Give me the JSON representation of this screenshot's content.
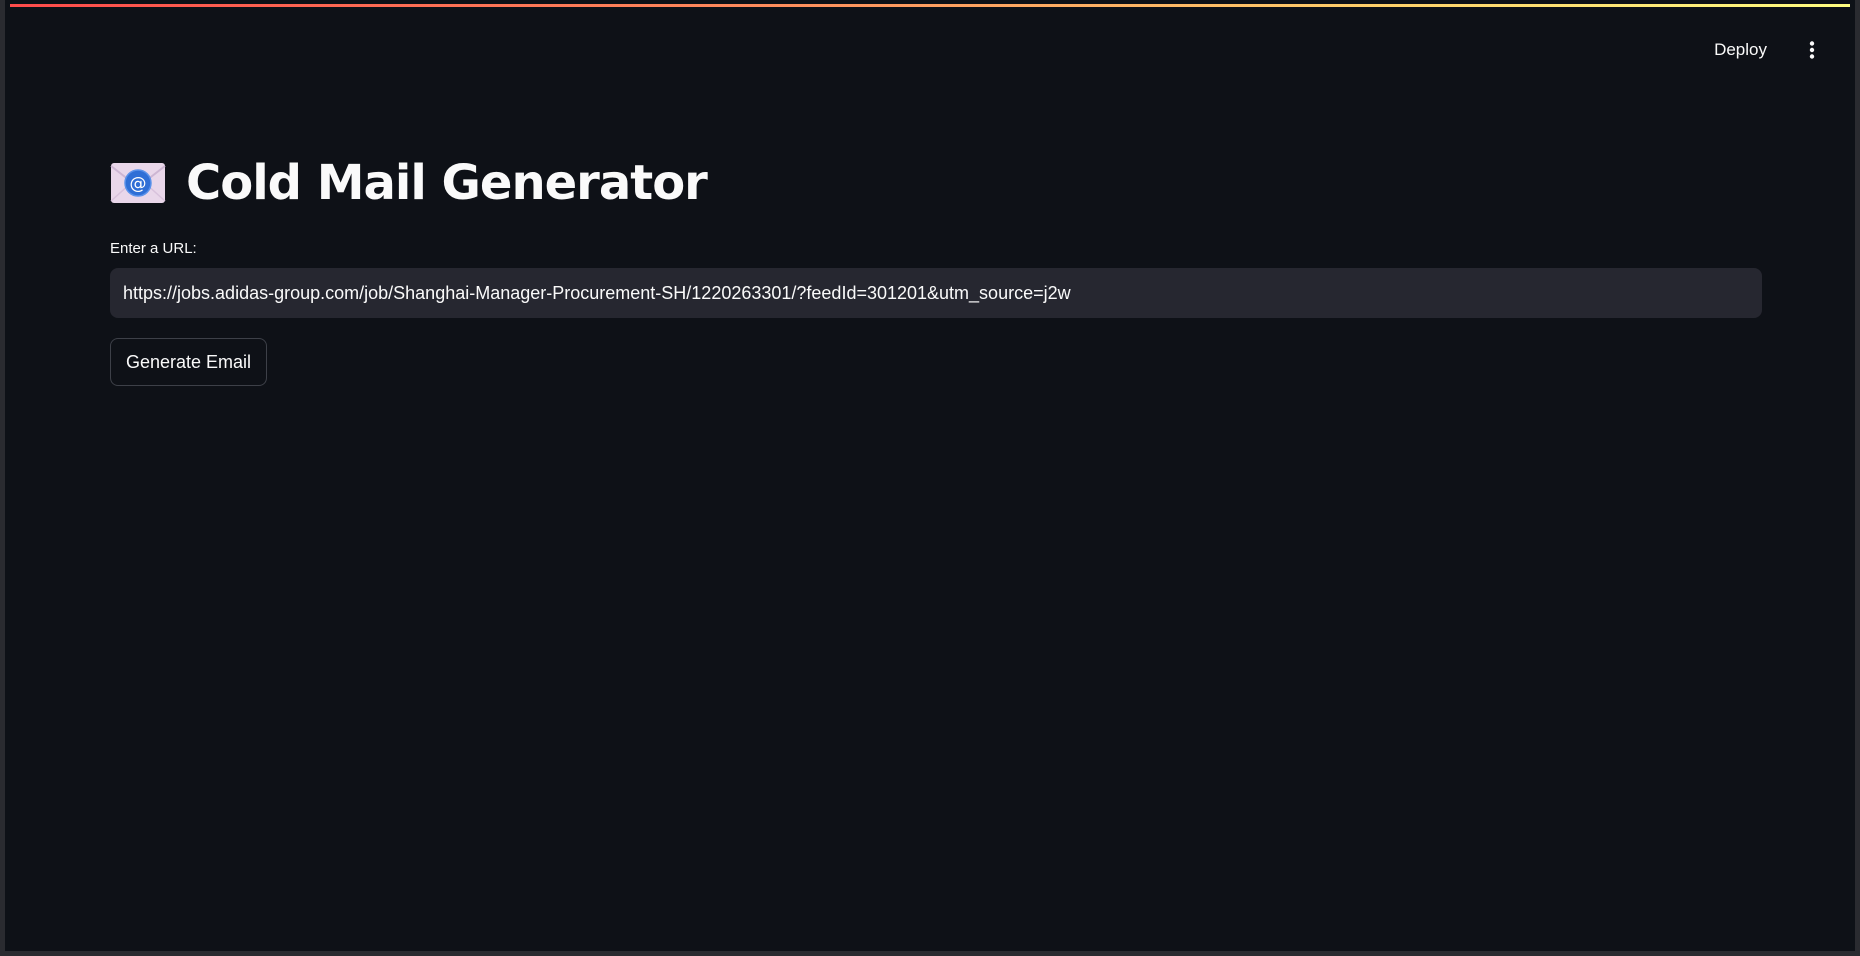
{
  "header": {
    "deploy_label": "Deploy",
    "menu_icon": "vertical-ellipsis-icon"
  },
  "main": {
    "title_icon": "email-envelope-icon",
    "title": "Cold Mail Generator",
    "url_label": "Enter a URL:",
    "url_value": "https://jobs.adidas-group.com/job/Shanghai-Manager-Procurement-SH/1220263301/?feedId=301201&utm_source=j2w",
    "generate_label": "Generate Email"
  },
  "colors": {
    "background": "#0e1117",
    "input_background": "#262730",
    "text": "#fafafa",
    "accent_gradient_start": "#ff4b4b",
    "accent_gradient_end": "#fffd80"
  }
}
